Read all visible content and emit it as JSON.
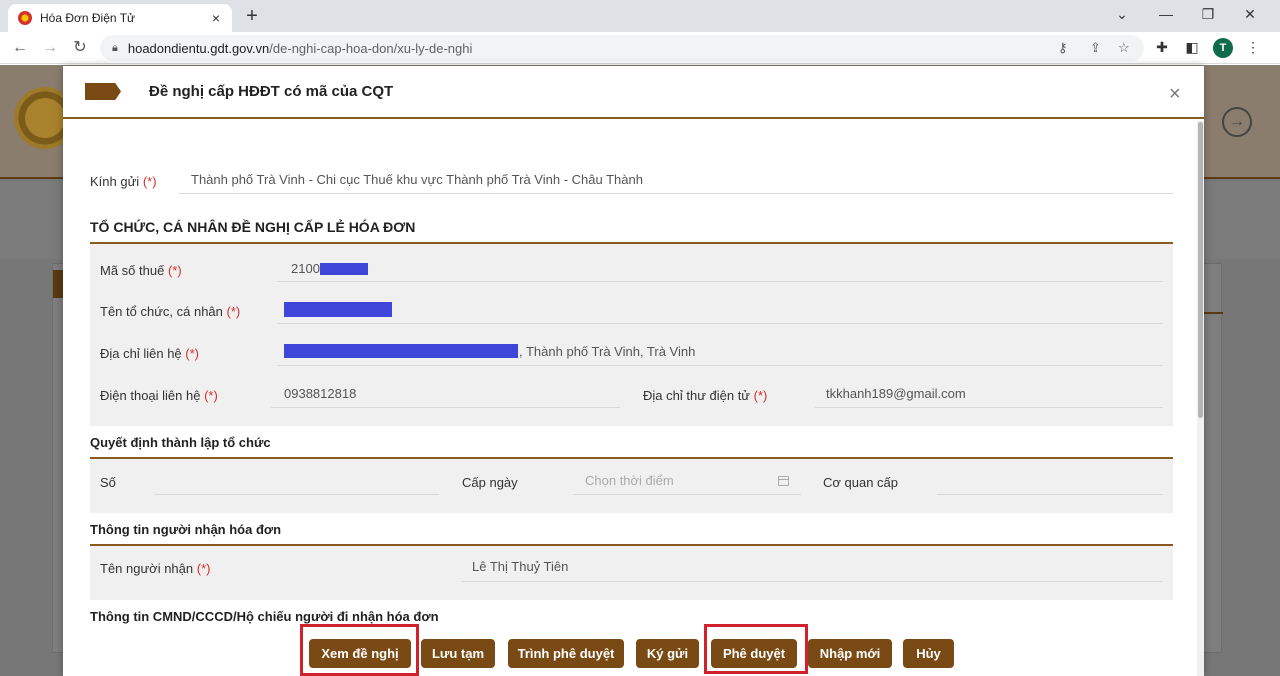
{
  "browser": {
    "tab_title": "Hóa Đơn Điện Tử",
    "tab_close": "×",
    "new_tab": "+",
    "url_domain": "hoadondientu.gdt.gov.vn",
    "url_path": "/de-nghi-cap-hoa-don/xu-ly-de-nghi",
    "profile_initial": "T"
  },
  "modal": {
    "title": "Đề nghị cấp HĐĐT có mã của CQT",
    "close": "×",
    "kinh_gui_label": "Kính gửi",
    "required_mark": "(*)",
    "kinh_gui_value": "Thành phố Trà Vinh - Chi cục Thuế khu vực Thành phố Trà Vinh - Châu Thành",
    "section1_title": "TỔ CHỨC, CÁ NHÂN ĐỀ NGHỊ CẤP LẺ HÓA ĐƠN",
    "mst_label": "Mã số thuế",
    "mst_value": "2100",
    "ten_label": "Tên tổ chức, cá nhân",
    "diachi_label": "Địa chỉ liên hệ",
    "diachi_value": ", Thành phố Trà Vinh, Trà Vinh",
    "dienthoai_label": "Điện thoại liên hệ",
    "dienthoai_value": "0938812818",
    "email_label": "Địa chỉ thư điện tử",
    "email_value": "tkkhanh189@gmail.com",
    "section2_title": "Quyết định thành lập tổ chức",
    "so_label": "Số",
    "capngay_label": "Cấp ngày",
    "capngay_placeholder": "Chọn thời điểm",
    "coquan_label": "Cơ quan cấp",
    "section3_title": "Thông tin người nhận hóa đơn",
    "nguoinhan_label": "Tên người nhận",
    "nguoinhan_value": "Lê Thị Thuỷ Tiên",
    "section4_title": "Thông tin CMND/CCCD/Hộ chiếu người đi nhận hóa đơn"
  },
  "buttons": {
    "xem": "Xem đề nghị",
    "luu": "Lưu tạm",
    "trinh": "Trình phê duyệt",
    "ky": "Ký gửi",
    "pheduyet": "Phê duyệt",
    "nhapmoi": "Nhập mới",
    "huy": "Hủy"
  }
}
